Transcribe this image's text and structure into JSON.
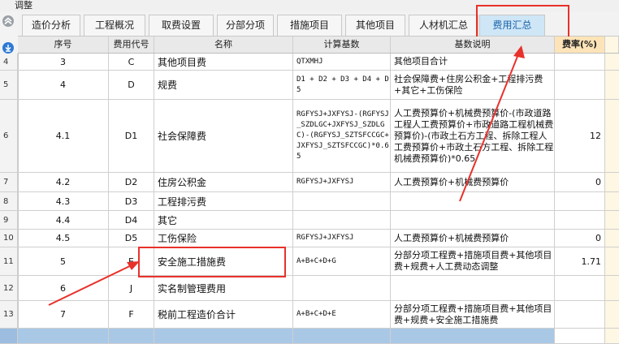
{
  "window": {
    "title": "调整"
  },
  "tabs": [
    {
      "label": "造价分析",
      "active": false
    },
    {
      "label": "工程概况",
      "active": false
    },
    {
      "label": "取费设置",
      "active": false
    },
    {
      "label": "分部分项",
      "active": false
    },
    {
      "label": "措施项目",
      "active": false
    },
    {
      "label": "其他项目",
      "active": false
    },
    {
      "label": "人材机汇总",
      "active": false
    },
    {
      "label": "费用汇总",
      "active": true
    }
  ],
  "table": {
    "columns": {
      "seq": "序号",
      "code": "费用代号",
      "name": "名称",
      "base": "计算基数",
      "base_desc": "基数说明",
      "rate": "费率(%)"
    },
    "rows": [
      {
        "num": "4",
        "seq": "3",
        "code": "C",
        "name": "其他项目费",
        "base": "QTXMHJ",
        "desc": "其他项目合计",
        "rate": ""
      },
      {
        "num": "5",
        "seq": "4",
        "code": "D",
        "name": "规费",
        "base": "D1 + D2 + D3 + D4 + D5",
        "desc": "社会保障费+住房公积金+工程排污费+其它+工伤保险",
        "rate": ""
      },
      {
        "num": "6",
        "seq": "4.1",
        "code": "D1",
        "name": "社会保障费",
        "base": "RGFYSJ+JXFYSJ-(RGFYSJ_SZDLGC+JXFYSJ_SZDLGC)-(RGFYSJ_SZTSFCCGC+JXFYSJ_SZTSFCCGC)*0.65",
        "desc": "人工费预算价+机械费预算价-(市政道路工程人工费预算价+市政道路工程机械费预算价)-(市政土石方工程、拆除工程人工费预算价+市政土石方工程、拆除工程机械费预算价)*0.65",
        "rate": "12"
      },
      {
        "num": "7",
        "seq": "4.2",
        "code": "D2",
        "name": "住房公积金",
        "base": "RGFYSJ+JXFYSJ",
        "desc": "人工费预算价+机械费预算价",
        "rate": "0"
      },
      {
        "num": "8",
        "seq": "4.3",
        "code": "D3",
        "name": "工程排污费",
        "base": "",
        "desc": "",
        "rate": ""
      },
      {
        "num": "9",
        "seq": "4.4",
        "code": "D4",
        "name": "其它",
        "base": "",
        "desc": "",
        "rate": ""
      },
      {
        "num": "10",
        "seq": "4.5",
        "code": "D5",
        "name": "工伤保险",
        "base": "RGFYSJ+JXFYSJ",
        "desc": "人工费预算价+机械费预算价",
        "rate": "0"
      },
      {
        "num": "11",
        "seq": "5",
        "code": "E",
        "name": "安全施工措施费",
        "base": "A+B+C+D+G",
        "desc": "分部分项工程费+措施项目费+其他项目费+规费+人工费动态调整",
        "rate": "1.71"
      },
      {
        "num": "12",
        "seq": "6",
        "code": "J",
        "name": "实名制管理费用",
        "base": "",
        "desc": "",
        "rate": ""
      },
      {
        "num": "13",
        "seq": "7",
        "code": "F",
        "name": "税前工程造价合计",
        "base": "A+B+C+D+E",
        "desc": "分部分项工程费+措施项目费+其他项目费+规费+安全施工措施费",
        "rate": ""
      }
    ]
  },
  "icons": {
    "collapse": "double-chevron-up-icon",
    "download": "download-icon"
  },
  "colors": {
    "annotation": "#e8312a",
    "active_tab": "#cfe6f7",
    "rate_header": "#fde4b8",
    "selected_row": "#a9c8e6"
  }
}
